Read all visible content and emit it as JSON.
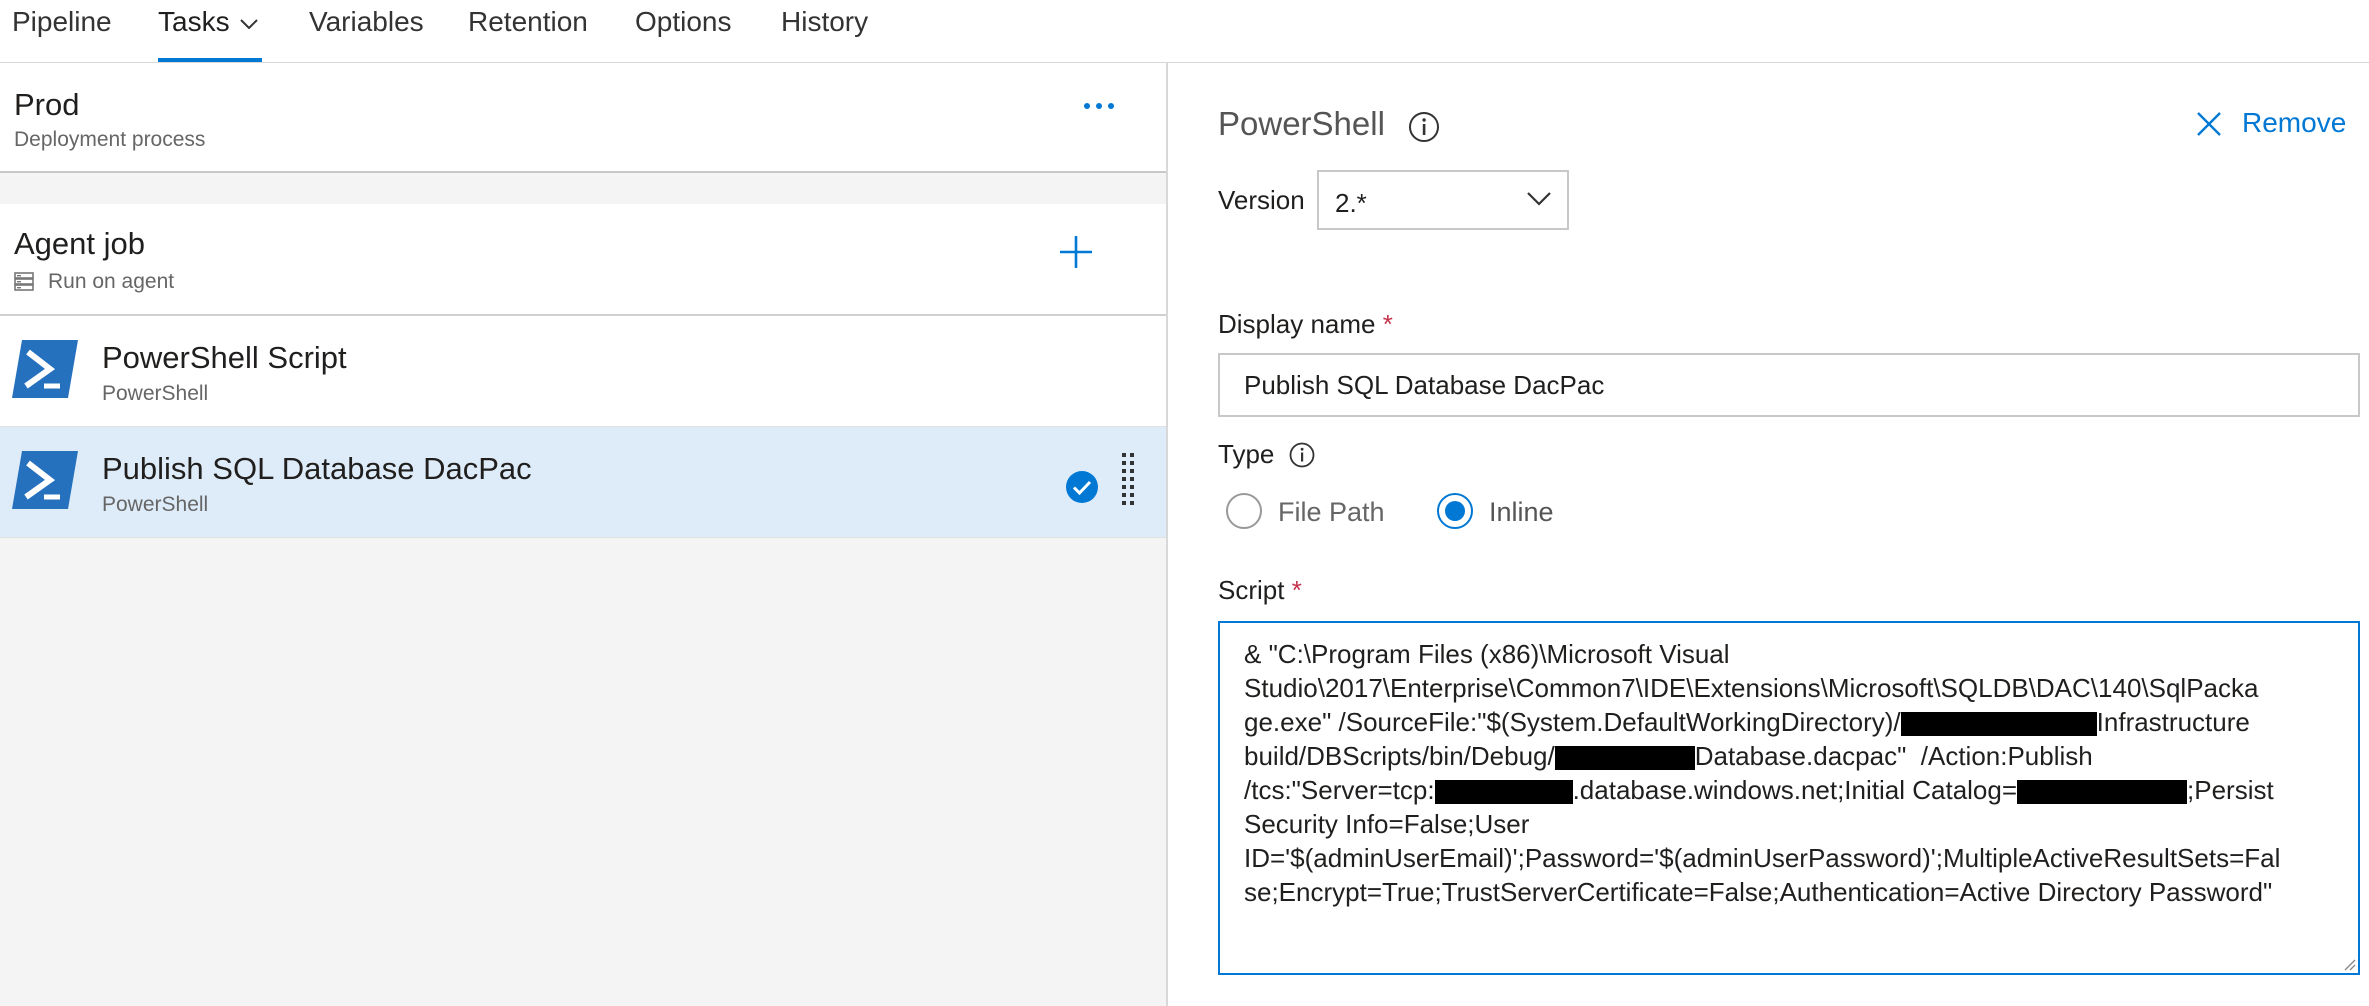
{
  "nav": {
    "tabs": [
      {
        "label": "Pipeline"
      },
      {
        "label": "Tasks"
      },
      {
        "label": "Variables"
      },
      {
        "label": "Retention"
      },
      {
        "label": "Options"
      },
      {
        "label": "History"
      }
    ],
    "active": "Tasks"
  },
  "stage": {
    "title": "Prod",
    "subtitle": "Deployment process"
  },
  "job": {
    "title": "Agent job",
    "subtitle": "Run on agent"
  },
  "tasks": [
    {
      "title": "PowerShell Script",
      "subtitle": "PowerShell"
    },
    {
      "title": "Publish SQL Database DacPac",
      "subtitle": "PowerShell",
      "selected": true
    }
  ],
  "details": {
    "title": "PowerShell",
    "remove_label": "Remove",
    "version_label": "Version",
    "version_value": "2.*",
    "display_name_label": "Display name",
    "required_marker": "*",
    "display_name_value": "Publish SQL Database DacPac",
    "type_label": "Type",
    "type_options": [
      "File Path",
      "Inline"
    ],
    "type_selected": "Inline",
    "script_label": "Script",
    "script_lines": [
      "& \"C:\\Program Files (x86)\\Microsoft Visual",
      "Studio\\2017\\Enterprise\\Common7\\IDE\\Extensions\\Microsoft\\SQLDB\\DAC\\140\\SqlPacka",
      "ge.exe\" /SourceFile:\"$(System.DefaultWorkingDirectory)/",
      "Infrastructure",
      "build/DBScripts/bin/Debug/",
      "Database.dacpac\"  /Action:Publish",
      "/tcs:\"Server=tcp:",
      ".database.windows.net;Initial Catalog=",
      ";Persist",
      "Security Info=False;User",
      "ID='$(adminUserEmail)';Password='$(adminUserPassword)';MultipleActiveResultSets=Fal",
      "se;Encrypt=True;TrustServerCertificate=False;Authentication=Active Directory Password\""
    ]
  },
  "colors": {
    "accent": "#0078d4",
    "selected_row": "#deecf9",
    "required": "#c4314b"
  }
}
